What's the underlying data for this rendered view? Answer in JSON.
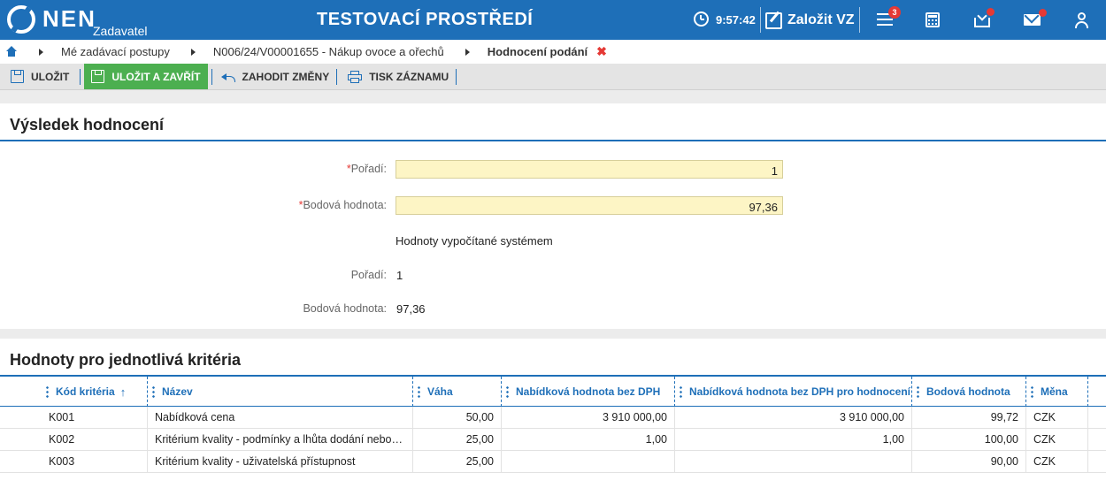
{
  "header": {
    "brand": "NEN",
    "brand_sub": "Zadavatel",
    "env_title": "TESTOVACÍ PROSTŘEDÍ",
    "time": "9:57:42",
    "new_vz_label": "Založit VZ",
    "menu_badge": "3",
    "colors": {
      "bar": "#1e6fb8",
      "badge": "#e53935"
    }
  },
  "breadcrumb": {
    "items": [
      "Mé zadávací postupy",
      "N006/24/V00001655 - Nákup ovoce a ořechů"
    ],
    "current": "Hodnocení podání",
    "close": "✖"
  },
  "toolbar": {
    "save": "ULOŽIT",
    "save_close": "ULOŽIT A ZAVŘÍT",
    "discard": "ZAHODIT ZMĚNY",
    "print": "TISK ZÁZNAMU"
  },
  "result": {
    "title": "Výsledek hodnocení",
    "req_mark": "*",
    "order_label": "Pořadí:",
    "order_value": "1",
    "score_label": "Bodová hodnota:",
    "score_value": "97,36",
    "system_heading": "Hodnoty vypočítané systémem",
    "sys_order_label": "Pořadí:",
    "sys_order_value": "1",
    "sys_score_label": "Bodová hodnota:",
    "sys_score_value": "97,36"
  },
  "criteria": {
    "title": "Hodnoty pro jednotlivá kritéria",
    "sort_arrow": "↑",
    "columns": [
      "Kód kritéria",
      "Název",
      "Váha",
      "Nabídková hodnota bez DPH",
      "Nabídková hodnota bez DPH pro hodnocení",
      "Bodová hodnota",
      "Měna"
    ],
    "rows": [
      [
        "K001",
        "Nabídková cena",
        "50,00",
        "3 910 000,00",
        "3 910 000,00",
        "99,72",
        "CZK"
      ],
      [
        "K002",
        "Kritérium kvality - podmínky a lhůta dodání nebo vyzvednutí",
        "25,00",
        "1,00",
        "1,00",
        "100,00",
        "CZK"
      ],
      [
        "K003",
        "Kritérium kvality - uživatelská přístupnost",
        "25,00",
        "",
        "",
        "90,00",
        "CZK"
      ]
    ]
  }
}
